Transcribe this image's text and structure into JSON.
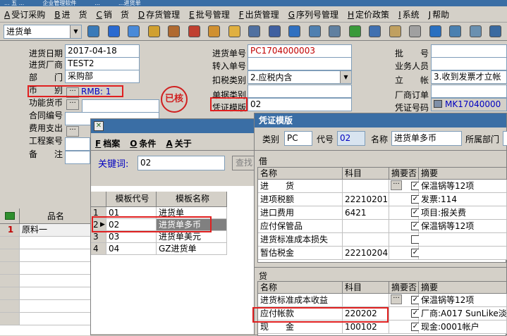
{
  "window": {
    "title_fragments": [
      "... 五 ...",
      "企业管理软件",
      "...",
      "...进货单"
    ]
  },
  "menu": [
    {
      "key": "A",
      "label": "受订采购"
    },
    {
      "key": "B",
      "label": "进　货"
    },
    {
      "key": "C",
      "label": "销　货"
    },
    {
      "key": "D",
      "label": "存货管理"
    },
    {
      "key": "E",
      "label": "批号管理"
    },
    {
      "key": "F",
      "label": "出货管理"
    },
    {
      "key": "G",
      "label": "序列号管理"
    },
    {
      "key": "H",
      "label": "定价政策"
    },
    {
      "key": "I",
      "label": "系统"
    },
    {
      "key": "J",
      "label": "帮助"
    }
  ],
  "toolbar": {
    "doc_type": "进货单",
    "icons": [
      "save-icon",
      "export-icon",
      "phone-icon",
      "folder-icon",
      "briefcase-icon",
      "home-icon",
      "people-icon",
      "note-icon",
      "printer-icon",
      "link-icon",
      "help-icon",
      "person-icon",
      "stamp-icon",
      "money-icon",
      "grid-icon",
      "tray-icon",
      "doc-icon",
      "check-icon",
      "edit-icon",
      "find-icon",
      "tree-icon",
      "network-icon"
    ]
  },
  "form": {
    "left": [
      {
        "label": "进货日期",
        "value": "2017-04-18"
      },
      {
        "label": "进货厂商",
        "value": "TEST2"
      },
      {
        "label": "部　　门",
        "value": "采购部"
      },
      {
        "label": "币　　别",
        "value": "RMB: 1"
      },
      {
        "label": "功能货币",
        "value": ""
      },
      {
        "label": "合同编号",
        "value": ""
      },
      {
        "label": "费用支出",
        "value": ""
      },
      {
        "label": "工程案号",
        "value": ""
      },
      {
        "label": "备　　注",
        "value": ""
      }
    ],
    "middle": [
      {
        "label": "进货单号",
        "value": "PC1704000003"
      },
      {
        "label": "转入单号",
        "value": ""
      },
      {
        "label": "扣税类别",
        "value": "2.应税内含"
      },
      {
        "label": "单据类别",
        "value": ""
      },
      {
        "label": "凭证模版",
        "value": "02"
      }
    ],
    "right": [
      {
        "label": "批　　号",
        "value": ""
      },
      {
        "label": "业务人员",
        "value": ""
      },
      {
        "label": "立　　帐",
        "value": "3.收到发票才立帐"
      },
      {
        "label": "厂商订单",
        "value": ""
      },
      {
        "label": "凭证号码",
        "value": "MK17040000"
      }
    ],
    "stamp_text": "已核"
  },
  "grid": {
    "header": "品名",
    "rows": [
      {
        "num": "1",
        "name": "原料一"
      }
    ]
  },
  "template_dialog": {
    "menu": [
      {
        "key": "F",
        "label": "档案"
      },
      {
        "key": "O",
        "label": "条件"
      },
      {
        "key": "A",
        "label": "关于"
      }
    ],
    "keyword_label": "关键词:",
    "keyword_value": "02",
    "search_label": "查找",
    "columns": [
      "模板代号",
      "模板名称"
    ],
    "rows": [
      {
        "num": "1",
        "code": "01",
        "name": "进货单"
      },
      {
        "num": "2",
        "code": "02",
        "name": "进货单多币"
      },
      {
        "num": "3",
        "code": "03",
        "name": "进货单美元"
      },
      {
        "num": "4",
        "code": "04",
        "name": "GZ进货单"
      }
    ],
    "selected_row": 1
  },
  "voucher_dialog": {
    "title": "凭证模版",
    "category_label": "类别",
    "category_value": "PC",
    "code_label": "代号",
    "code_value": "02",
    "name_label": "名称",
    "name_value": "进货单多币",
    "dept_label": "所属部门",
    "debit_title": "借",
    "credit_title": "贷",
    "columns": [
      "名称",
      "科目",
      "摘要否",
      "摘要"
    ],
    "debit_rows": [
      {
        "name": "进　　货",
        "account": "",
        "checked": true,
        "summary": "保温锅等12项",
        "has_dots": true
      },
      {
        "name": "进项税额",
        "account": "22210201",
        "checked": true,
        "summary": "发票:114",
        "has_dots": false
      },
      {
        "name": "进口费用",
        "account": "6421",
        "checked": true,
        "summary": "项目:报关费",
        "has_dots": false
      },
      {
        "name": "应付保管品",
        "account": "",
        "checked": true,
        "summary": "保温锅等12项",
        "has_dots": false
      },
      {
        "name": "进货标准成本损失",
        "account": "",
        "checked": false,
        "summary": "",
        "has_dots": false
      },
      {
        "name": "暂估税金",
        "account": "22210204",
        "checked": true,
        "summary": "",
        "has_dots": false
      }
    ],
    "credit_rows": [
      {
        "name": "进货标准成本收益",
        "account": "",
        "checked": true,
        "summary": "保温锅等12项",
        "has_dots": true
      },
      {
        "name": "应付帐款",
        "account": "220202",
        "checked": true,
        "summary": "厂商:A017 SunLike淡",
        "has_dots": false
      },
      {
        "name": "现　　金",
        "account": "100102",
        "checked": true,
        "summary": "现金:0001帐户",
        "has_dots": false
      }
    ]
  },
  "colors": {
    "highlight": "#e02020",
    "selected_row": "#808080",
    "title_bar": "#3a6ea5"
  }
}
